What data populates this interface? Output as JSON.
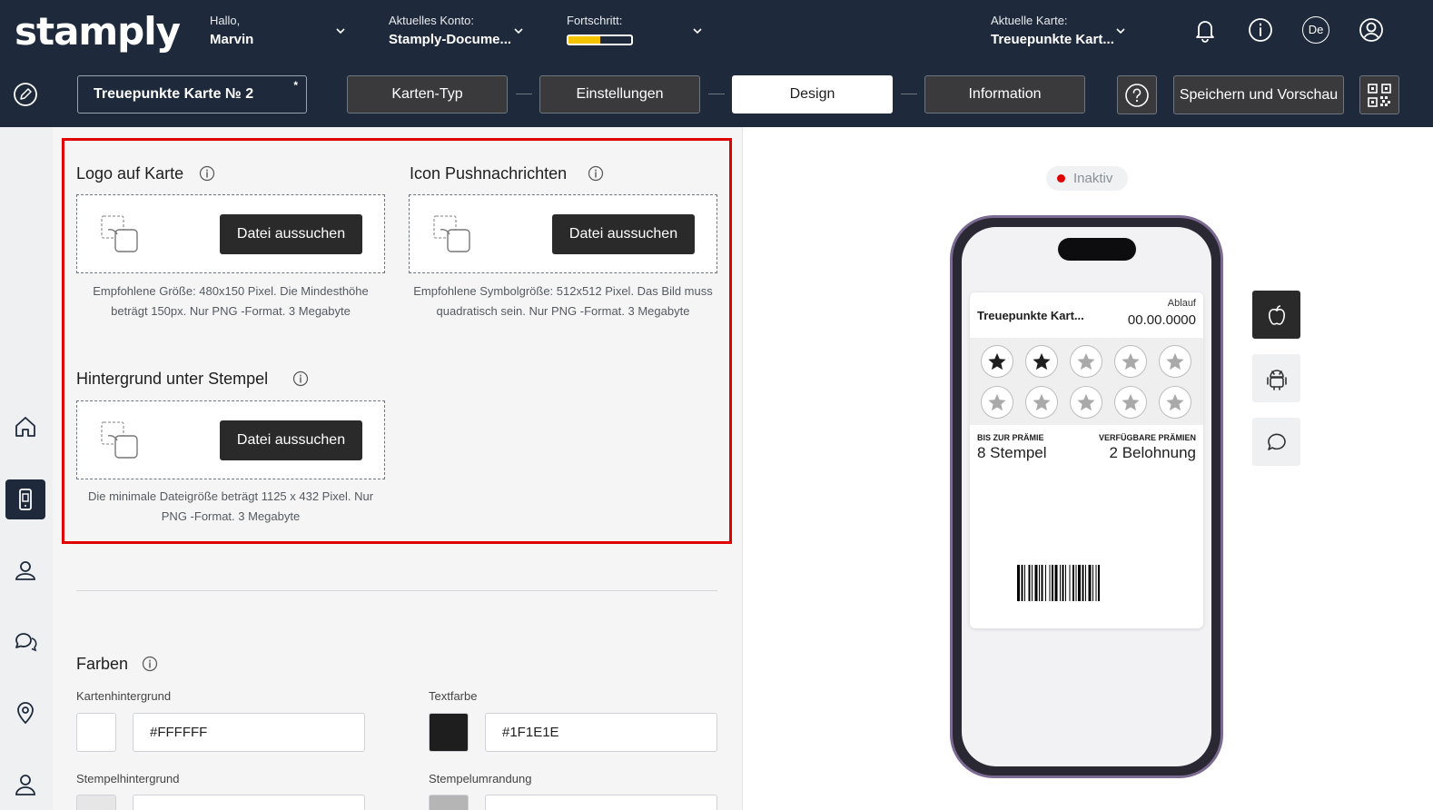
{
  "header": {
    "logo": "stamply",
    "greeting_label": "Hallo,",
    "user_name": "Marvin",
    "account_label": "Aktuelles Konto:",
    "account_value": "Stamply-Docume...",
    "progress_label": "Fortschritt:",
    "progress_fraction": 0.5,
    "card_label": "Aktuelle Karte:",
    "card_value": "Treuepunkte Kart...",
    "lang_badge": "De"
  },
  "nav": {
    "card_title": "Treuepunkte Karte № 2",
    "card_title_marker": "*",
    "steps": [
      "Karten-Typ",
      "Einstellungen",
      "Design",
      "Information"
    ],
    "active_step": "Design",
    "save_label": "Speichern und Vorschau"
  },
  "sections": {
    "logo": {
      "title": "Logo auf Karte",
      "button": "Datei aussuchen",
      "hint_line1": "Empfohlene Größe: 480x150 Pixel. Die Mindesthöhe",
      "hint_line2": "beträgt 150px. Nur PNG -Format. 3 Megabyte"
    },
    "icon": {
      "title": "Icon Pushnachrichten",
      "button": "Datei aussuchen",
      "hint_line1": "Empfohlene Symbolgröße: 512x512 Pixel. Das Bild muss",
      "hint_line2": "quadratisch sein. Nur PNG -Format. 3 Megabyte"
    },
    "background": {
      "title": "Hintergrund unter Stempel",
      "button": "Datei aussuchen",
      "hint_line1": "Die minimale Dateigröße beträgt 1125 x 432 Pixel. Nur",
      "hint_line2": "PNG -Format. 3 Megabyte"
    }
  },
  "colors": {
    "title": "Farben",
    "card_bg_label": "Kartenhintergrund",
    "card_bg_value": "#FFFFFF",
    "text_color_label": "Textfarbe",
    "text_color_value": "#1F1E1E",
    "stamp_bg_label": "Stempelhintergrund",
    "stamp_border_label": "Stempelumrandung",
    "stamp_bg_swatch": "#e6e6e6",
    "stamp_border_swatch": "#b5b5b5"
  },
  "preview": {
    "status": "Inaktiv",
    "pass_title": "Treuepunkte Kart...",
    "expiry_label": "Ablauf",
    "expiry_value": "00.00.0000",
    "field1_label": "BIS ZUR PRÄMIE",
    "field1_value": "8 Stempel",
    "field2_label": "VERFÜGBARE PRÄMIEN",
    "field2_value": "2 Belohnung",
    "stamps_total": 10,
    "stamps_filled": 2
  },
  "theme": {
    "header_bg": "#1e2a3b",
    "accent_yellow": "#f5c400",
    "highlight_red": "#e10000"
  }
}
